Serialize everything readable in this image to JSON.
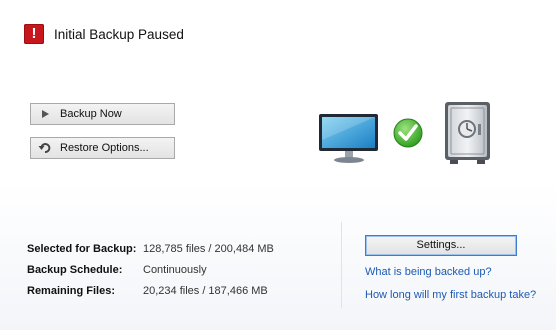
{
  "header": {
    "title": "Initial Backup Paused",
    "alert_glyph": "!"
  },
  "actions": {
    "backup_now_label": "Backup Now",
    "restore_options_label": "Restore Options..."
  },
  "status": [
    {
      "label": "Selected for Backup:",
      "value": "128,785 files / 200,484 MB"
    },
    {
      "label": "Backup Schedule:",
      "value": "Continuously"
    },
    {
      "label": "Remaining Files:",
      "value": "20,234 files / 187,466 MB"
    }
  ],
  "settings": {
    "button_label": "Settings..."
  },
  "links": [
    {
      "text": "What is being backed up?"
    },
    {
      "text": "How long will my first backup take?"
    }
  ],
  "colors": {
    "alert_red": "#c8161d",
    "link_blue": "#1d5ab4",
    "check_green": "#2fae1f"
  },
  "icons": {
    "alert": "exclamation-icon",
    "backup": "play-icon",
    "restore": "restore-arrow-icon",
    "computer": "monitor-icon",
    "status": "checkmark-icon",
    "vault": "safe-icon"
  }
}
